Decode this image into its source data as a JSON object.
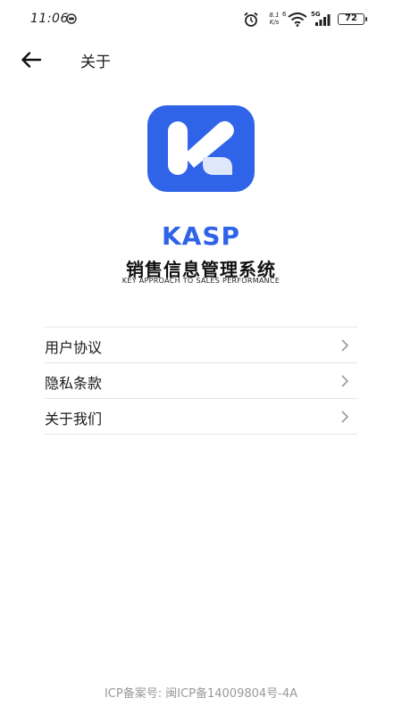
{
  "status_bar": {
    "time": "11:06",
    "net_speed_value": "8.1",
    "net_speed_unit": "K/s",
    "wifi_label": "6",
    "network_type": "5G",
    "battery": "72",
    "icons": [
      "alarm-icon",
      "wifi-icon",
      "signal-icon",
      "battery-icon"
    ]
  },
  "header": {
    "title": "关于",
    "back_icon": "arrow-left-icon"
  },
  "brand": {
    "name": "KASP",
    "cn_title": "销售信息管理系统",
    "en_subtitle": "KEY APPROACH TO SALES PERFORMANCE",
    "accent_color": "#2f63e8"
  },
  "menu": {
    "items": [
      {
        "label": "用户协议"
      },
      {
        "label": "隐私条款"
      },
      {
        "label": "关于我们"
      }
    ]
  },
  "footer": {
    "icp": "ICP备案号: 闽ICP备14009804号-4A"
  }
}
